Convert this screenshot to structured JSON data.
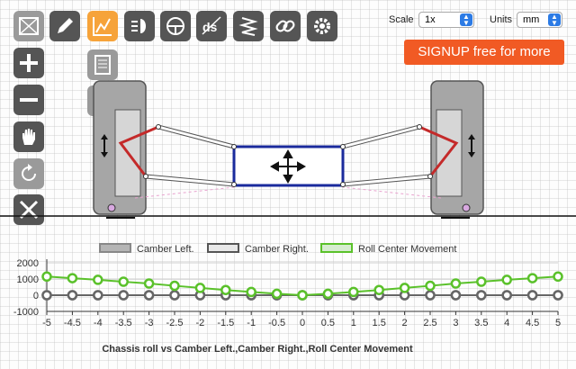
{
  "toolbar": {
    "icons": [
      "crop-icon",
      "pencil-icon",
      "chart-icon",
      "headlight-icon",
      "steering-icon",
      "ds-icon",
      "spring-icon",
      "link-icon",
      "gear-icon"
    ],
    "side_icons": [
      "zoom-in-icon",
      "zoom-out-icon",
      "pan-hand-icon",
      "rotate-icon",
      "tools-icon"
    ],
    "mid_icons": [
      "notes-icon",
      "download-icon"
    ]
  },
  "controls": {
    "scale_label": "Scale",
    "scale_value": "1x",
    "units_label": "Units",
    "units_value": "mm"
  },
  "signup_label": "SIGNUP free for more",
  "colors": {
    "accent": "#f6a33a",
    "signup": "#f15a24",
    "chassis": "#1a2a9c",
    "arm": "#cc2a2a",
    "series_green": "#5ac12a",
    "series_gray": "#666666"
  },
  "chart_data": {
    "type": "line",
    "title": "Chassis roll vs Camber Left.,Camber Right.,Roll Center Movement",
    "x": [
      -5,
      -4.5,
      -4,
      -3.5,
      -3,
      -2.5,
      -2,
      -1.5,
      -1,
      -0.5,
      0,
      0.5,
      1,
      1.5,
      2,
      2.5,
      3,
      3.5,
      4,
      4.5,
      5
    ],
    "series": [
      {
        "name": "Camber Left.",
        "values": [
          0,
          0,
          0,
          0,
          0,
          0,
          0,
          0,
          0,
          0,
          0,
          0,
          0,
          0,
          0,
          0,
          0,
          0,
          0,
          0,
          0
        ]
      },
      {
        "name": "Camber Right.",
        "values": [
          0,
          0,
          0,
          0,
          0,
          0,
          0,
          0,
          0,
          0,
          0,
          0,
          0,
          0,
          0,
          0,
          0,
          0,
          0,
          0,
          0
        ]
      },
      {
        "name": "Roll Center Movement",
        "values": [
          1150,
          1050,
          950,
          830,
          720,
          580,
          450,
          320,
          200,
          90,
          0,
          90,
          200,
          320,
          450,
          580,
          720,
          830,
          950,
          1050,
          1150
        ]
      }
    ],
    "xticks": [
      "-5",
      "-4.5",
      "-4",
      "-3.5",
      "-3",
      "-2.5",
      "-2",
      "-1.5",
      "-1",
      "-0.5",
      "0",
      "0.5",
      "1",
      "1.5",
      "2",
      "2.5",
      "3",
      "3.5",
      "4",
      "4.5",
      "5"
    ],
    "yticks": [
      "2000",
      "1000",
      "0",
      "-1000"
    ],
    "ylim": [
      -1000,
      2000
    ],
    "legend": "top"
  }
}
